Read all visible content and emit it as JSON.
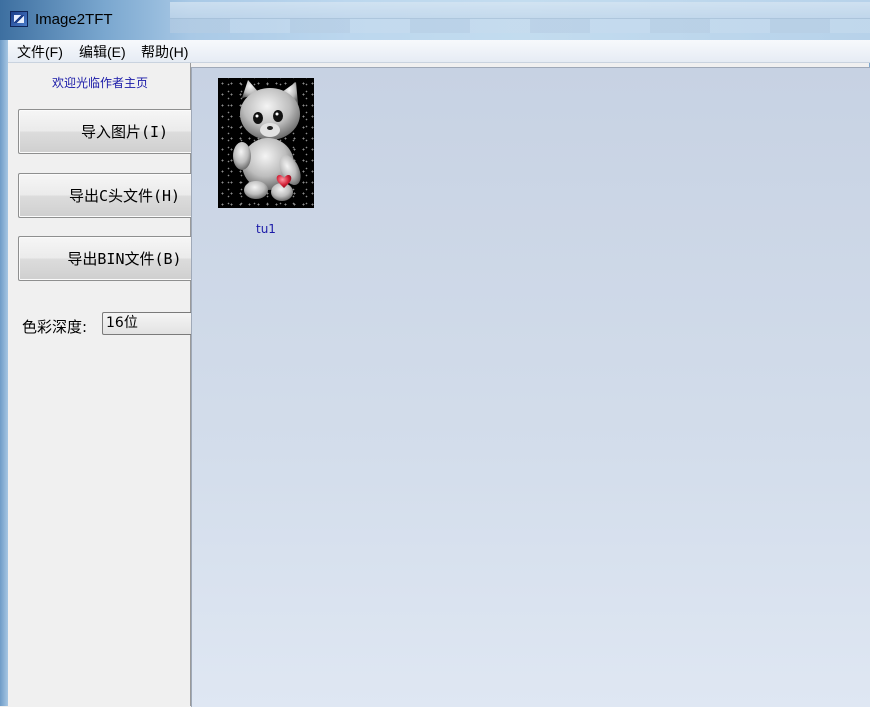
{
  "window": {
    "title": "Image2TFT"
  },
  "menu": {
    "items": [
      "文件(F)",
      "编辑(E)",
      "帮助(H)"
    ]
  },
  "left_panel": {
    "welcome_link": "欢迎光临作者主页",
    "buttons": {
      "import": "导入图片(I)",
      "export_c": "导出C头文件(H)",
      "export_bin": "导出BIN文件(B)"
    },
    "color_depth": {
      "label": "色彩深度:",
      "selected": "16位"
    }
  },
  "content": {
    "thumbnail": {
      "caption": "tu1"
    }
  },
  "icons": {
    "app": "app-icon",
    "dropdown": "chevron-down-icon",
    "thumbnail": "teddy-bear-image"
  }
}
